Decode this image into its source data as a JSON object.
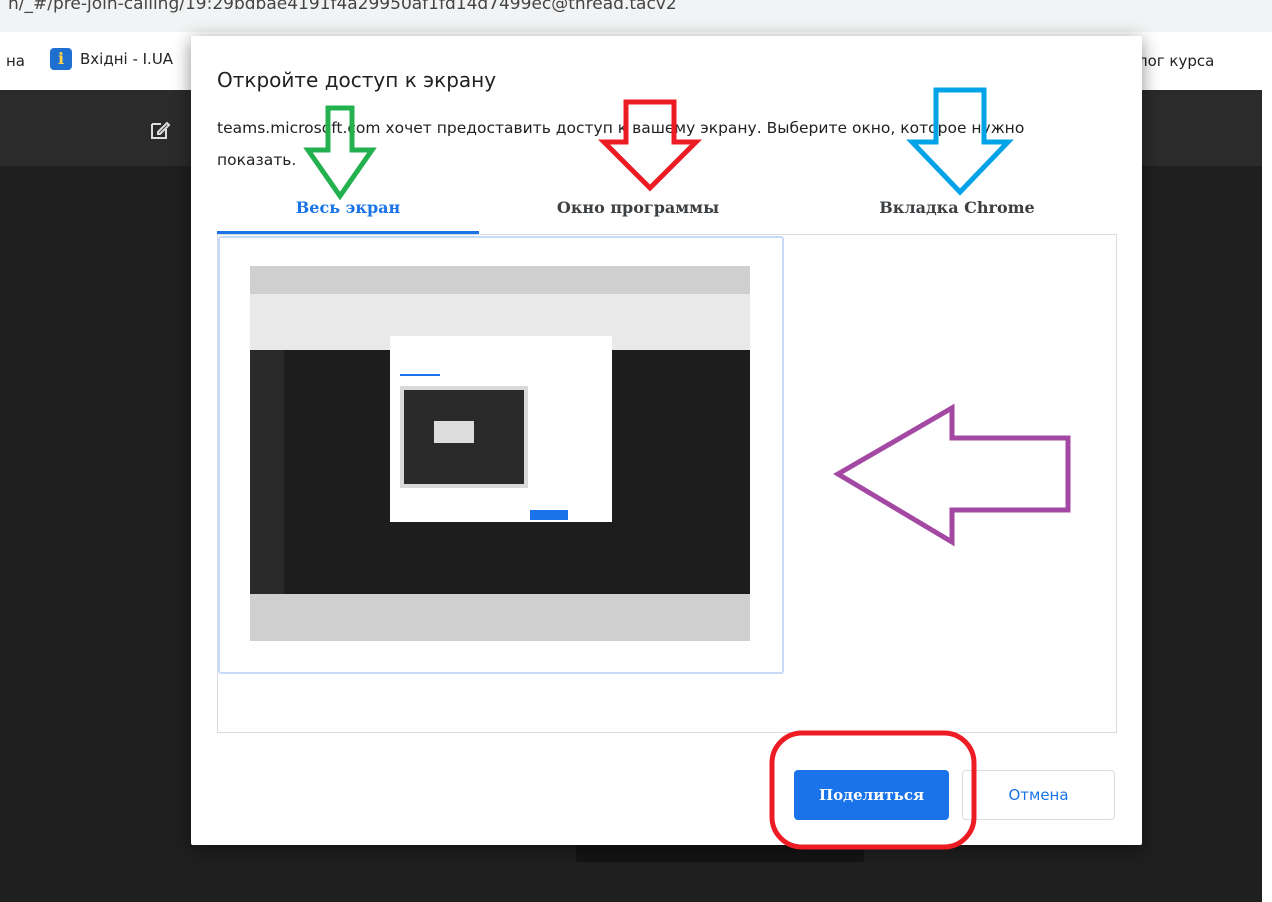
{
  "browser": {
    "url_fragment": "n/_#/pre-join-calling/19:29bdbae4191f4a29950af1fd14d7499ec@thread.tacv2",
    "bookmarks": {
      "left_partial": "на",
      "item_label": "Вхідні - I.UA",
      "right_partial": "лог курса"
    }
  },
  "dialog": {
    "title": "Откройте доступ к экрану",
    "subtitle": "teams.microsoft.com хочет предоставить доступ к вашему экрану. Выберите окно, которое нужно показать.",
    "tabs": [
      {
        "label": "Весь экран",
        "active": true
      },
      {
        "label": "Окно программы",
        "active": false
      },
      {
        "label": "Вкладка Chrome",
        "active": false
      }
    ],
    "share_label": "Поделиться",
    "cancel_label": "Отмена"
  },
  "annotations": {
    "arrow_colors": {
      "green": "#22b14c",
      "red": "#ed1c24",
      "blue": "#00a2e8",
      "purple": "#a349a4"
    },
    "highlight_color": "#ed1c24"
  },
  "colors": {
    "accent": "#1a73e8"
  }
}
